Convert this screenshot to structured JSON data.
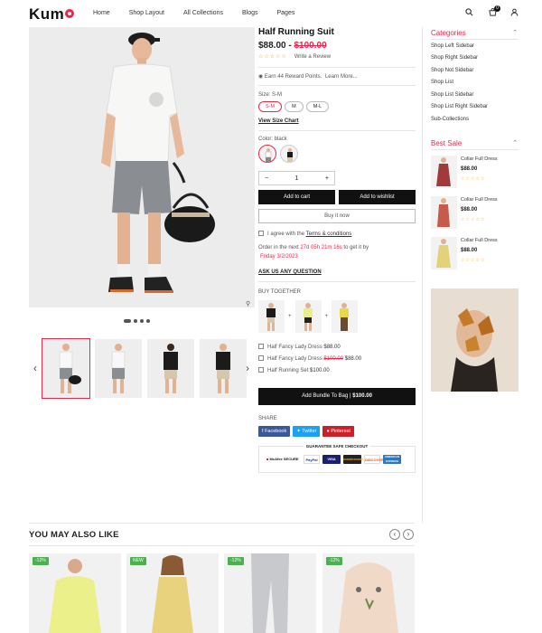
{
  "header": {
    "logo": "Kum",
    "nav": [
      "Home",
      "Shop Layout",
      "All Collections",
      "Blogs",
      "Pages"
    ],
    "cart_count": "0"
  },
  "product": {
    "title": "Half Running Suit",
    "price": "$88.00",
    "separator": " - ",
    "old_price": "$100.00",
    "stars": "☆☆☆☆☆",
    "write_review": "Write a Review",
    "reward_text": "Earn 44 Reward Points.",
    "learn_more": "Learn More...",
    "size_label": "Size: S-M",
    "sizes": [
      "S-M",
      "M",
      "M-L"
    ],
    "size_chart": "View Size Chart",
    "color_label": "Color: black",
    "quantity": "1",
    "add_to_cart": "Add to cart",
    "add_to_wishlist": "Add to wishlist",
    "buy_now": "Buy it now",
    "agree_text": "I agree with the",
    "terms": "Terms & conditions",
    "order_prefix": "Order in the next",
    "countdown": "27d 05h 21m 16s",
    "order_suffix": "to get it by",
    "delivery_date": "Friday 3/2/2023",
    "ask_question": "ASK US ANY QUESTION",
    "buy_together_label": "BUY TOGETHER",
    "bundle": [
      {
        "name": "Half Fancy Lady Dress",
        "price": "$88.00",
        "old": ""
      },
      {
        "name": "Half Fancy Lady Dress",
        "price": "$88.00",
        "old": "$100.00"
      },
      {
        "name": "Half Running Set",
        "price": "$100.00",
        "old": ""
      }
    ],
    "bundle_button": "Add Bundle To Bag",
    "bundle_total": "$100.00",
    "share_label": "SHARE",
    "share": [
      "Facebook",
      "Twitter",
      "Pinterest"
    ],
    "safe_checkout": "GUARANTEE SAFE CHECKOUT",
    "payments": [
      "McAfee SECURE",
      "PayPal",
      "VISA",
      "mastercard",
      "DISCOVER",
      "AMERICAN EXPRESS"
    ]
  },
  "sidebar": {
    "categories_title": "Categories",
    "categories": [
      "Shop Left Sidebar",
      "Shop Right Sidebar",
      "Shop Not Sidebar",
      "Shop List",
      "Shop List Sidebar",
      "Shop List Right Sidebar",
      "Sub-Collections"
    ],
    "best_sale_title": "Best Sale",
    "best_sale": [
      {
        "name": "Collar Full Dress",
        "price": "$88.00",
        "stars": "☆☆☆☆☆"
      },
      {
        "name": "Collar Full Dress",
        "price": "$88.00",
        "stars": "☆☆☆☆☆"
      },
      {
        "name": "Collar Full Dress",
        "price": "$88.00",
        "stars": "☆☆☆☆☆"
      }
    ]
  },
  "ymal": {
    "title": "YOU MAY ALSO LIKE",
    "tags": [
      "-12%",
      "NEW",
      "-12%",
      "-12%"
    ]
  },
  "colors": {
    "accent": "#e8274b",
    "dark": "#111111",
    "sale_tag": "#4caf50"
  }
}
